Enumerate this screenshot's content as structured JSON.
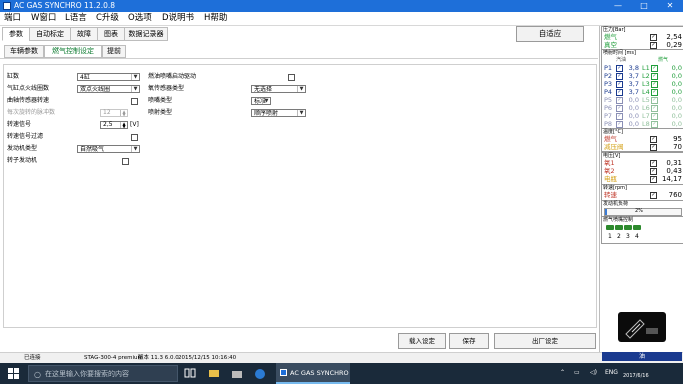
{
  "window": {
    "title": "AC GAS SYNCHRO  11.2.0.8",
    "minimize": "—",
    "maximize": "□",
    "close": "✕"
  },
  "menu": [
    "端口",
    "W窗口",
    "L语言",
    "C升级",
    "O选项",
    "D说明书",
    "H帮助"
  ],
  "main_tabs": [
    "参数",
    "自动标定",
    "故障",
    "图表",
    "数据记录器"
  ],
  "auto_button": "自适应",
  "sub_tabs": [
    "车辆参数",
    "燃气控制设定",
    "提前"
  ],
  "left_form": {
    "cylinders_label": "缸数",
    "cylinders_value": "4缸",
    "ignition_label": "气缸点火线圈数",
    "ignition_value": "双点火线圈",
    "crank_sensor_label": "曲轴传感器转速",
    "pulses_label": "每次旋转的脉冲数",
    "pulses_value": "12",
    "rpm_signal_label": "转速信号",
    "rpm_signal_value": "2,5",
    "rpm_signal_unit": "[V]",
    "rpm_filter_label": "转速信号过滤",
    "engine_type_label": "发动机类型",
    "engine_type_value": "自然吸气",
    "turbo_label": "转子发动机"
  },
  "right_form": {
    "fuel_injection_label": "燃油喷嘴启动驱动",
    "gas_sensor_label": "氧传感器类型",
    "gas_sensor_value": "无选择",
    "injector_type_label": "喷嘴类型",
    "injector_type_value": "标准",
    "sequence_label": "喷射类型",
    "sequence_value": "顺序喷射"
  },
  "bottom_buttons": {
    "load": "载入设定",
    "save": "保存",
    "factory": "出厂设定"
  },
  "status": {
    "connected": "已连接",
    "firmware": "STAG-300-4 premium",
    "version": "版本 11.3  6.0.0",
    "datetime": "2015/12/15 10:16:40"
  },
  "right_panel": {
    "pressure_title": "压力[Bar]",
    "pressure": [
      {
        "label": "燃气",
        "value": "2,54",
        "color": "#1f9e3a",
        "checked": true
      },
      {
        "label": "真空",
        "value": "0,29",
        "color": "#1f9e3a",
        "checked": true
      }
    ],
    "inj_title": "喷射时间 [ms]",
    "inj_col_petrol": "汽油",
    "inj_col_gas": "燃气",
    "injectors": [
      {
        "petrol": "P1",
        "pval": "3,8",
        "gas": "L1",
        "gval": "0,0",
        "active": true
      },
      {
        "petrol": "P2",
        "pval": "3,7",
        "gas": "L2",
        "gval": "0,0",
        "active": true
      },
      {
        "petrol": "P3",
        "pval": "3,7",
        "gas": "L3",
        "gval": "0,0",
        "active": true
      },
      {
        "petrol": "P4",
        "pval": "3,7",
        "gas": "L4",
        "gval": "0,0",
        "active": true
      },
      {
        "petrol": "P5",
        "pval": "0,0",
        "gas": "L5",
        "gval": "0,0",
        "active": false
      },
      {
        "petrol": "P6",
        "pval": "0,0",
        "gas": "L6",
        "gval": "0,0",
        "active": false
      },
      {
        "petrol": "P7",
        "pval": "0,0",
        "gas": "L7",
        "gval": "0,0",
        "active": false
      },
      {
        "petrol": "P8",
        "pval": "0,0",
        "gas": "L8",
        "gval": "0,0",
        "active": false
      }
    ],
    "temp_title": "温度[°C]",
    "temps": [
      {
        "label": "燃气",
        "value": "95",
        "color": "#c0392b",
        "checked": true
      },
      {
        "label": "减压阀",
        "value": "70",
        "color": "#d4a017",
        "checked": true
      }
    ],
    "voltage_title": "电压[V]",
    "voltages": [
      {
        "label": "氧1",
        "value": "0,31",
        "color": "#c0392b",
        "checked": true
      },
      {
        "label": "氧2",
        "value": "0,43",
        "color": "#c0392b",
        "checked": true
      },
      {
        "label": "电瓶",
        "value": "14,17",
        "color": "#d4a017",
        "checked": true
      }
    ],
    "rpm_title": "转速[rpm]",
    "rpm": {
      "label": "转速",
      "value": "760",
      "color": "#c0392b",
      "checked": true
    },
    "load_title": "发动机负荷",
    "load_value": "2%",
    "load_fraction": 0.02,
    "gas_valve_title": "燃气喷嘴控制",
    "valve_labels": [
      "1",
      "2",
      "3",
      "4"
    ],
    "mode_label": "油"
  },
  "taskbar": {
    "search_placeholder": "在这里输入你要搜索的内容",
    "app_label": "AC GAS SYNCHRO",
    "lang": "ENG",
    "time": "2017/6/16"
  },
  "colors": {
    "titlebar": "#1e6fd9",
    "accent_green": "#0a7a2e",
    "mode_bar": "#1a3a8f"
  }
}
